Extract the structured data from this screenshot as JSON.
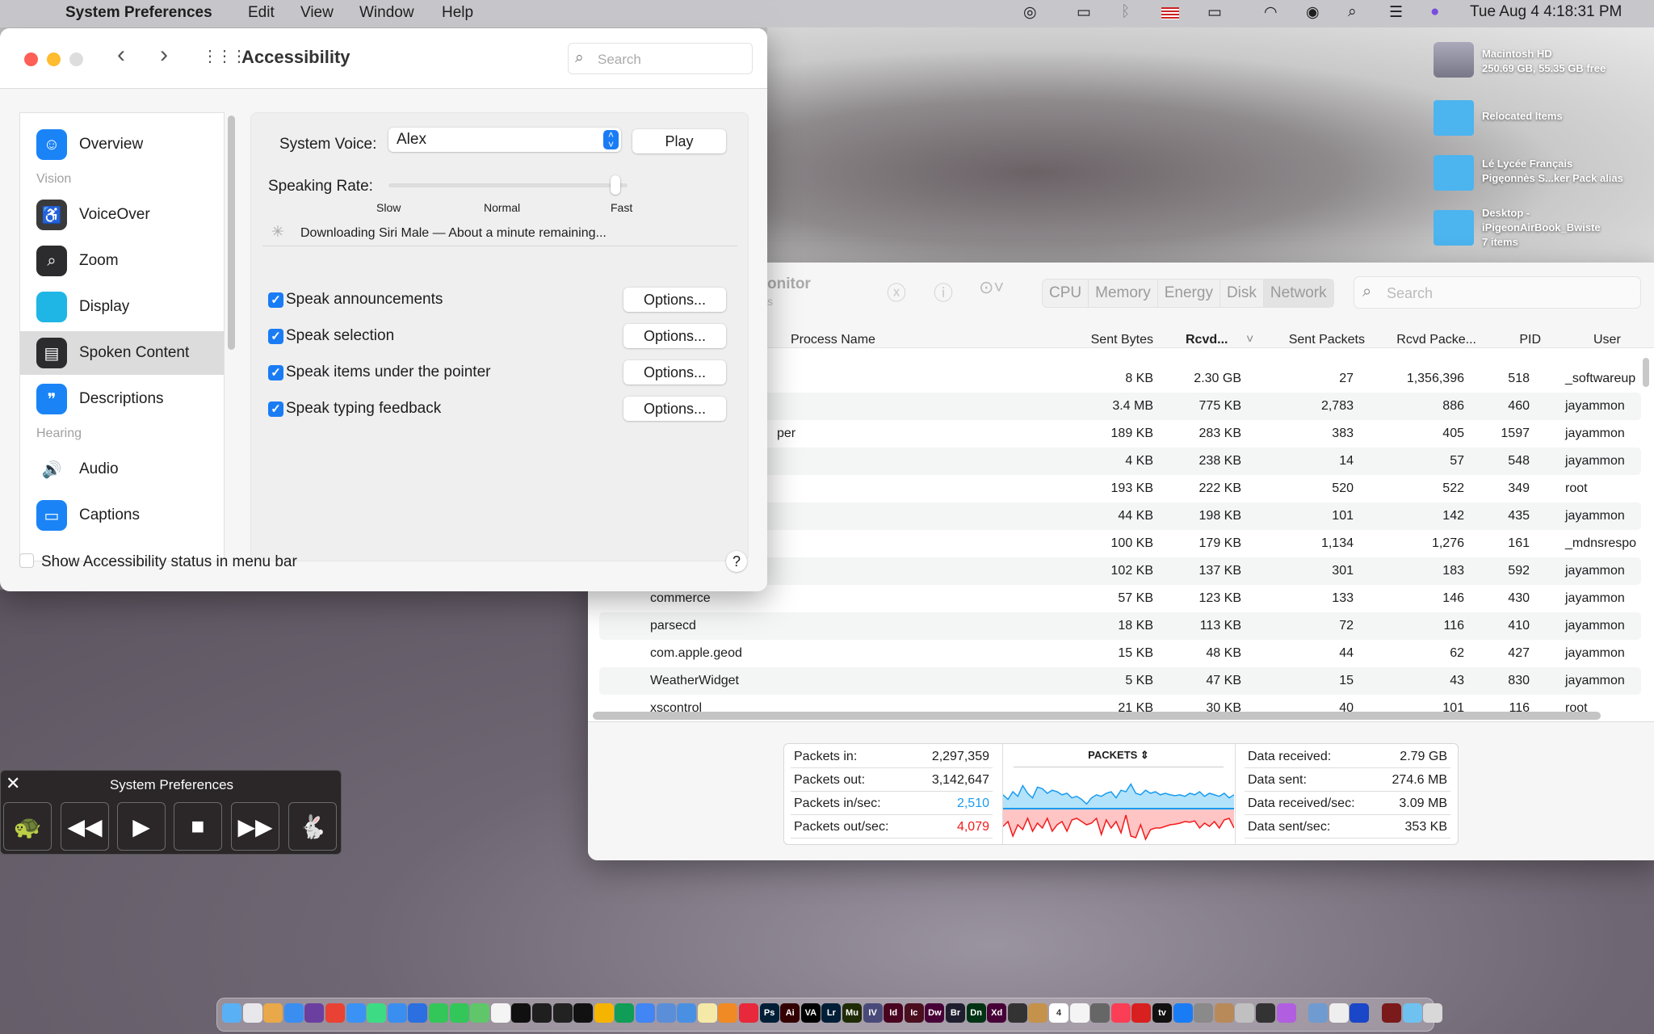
{
  "menubar": {
    "app": "System Preferences",
    "items": [
      "Edit",
      "View",
      "Window",
      "Help"
    ],
    "clock": "Tue Aug 4  4:18:31 PM",
    "status_icons": [
      "creative-cloud-icon",
      "display-icon",
      "bluetooth-icon",
      "us-flag-icon",
      "battery-charging-icon",
      "wifi-icon",
      "user-icon",
      "spotlight-icon",
      "control-center-icon",
      "siri-icon"
    ]
  },
  "desktop": {
    "items": [
      {
        "name": "Macintosh HD",
        "sub": "250.69 GB, 55.35 GB free",
        "icon": "hard-drive-icon"
      },
      {
        "name": "Relocated Items",
        "sub": "",
        "icon": "folder-alias-icon"
      },
      {
        "name": "Lé Lycée Français",
        "sub": "Pigęonnès S...ker Pack alias",
        "icon": "folder-alias-icon"
      },
      {
        "name": "Desktop -",
        "sub": "iPigeonAirBook_Bwiste",
        "sub2": "7 items",
        "icon": "folder-icon"
      }
    ]
  },
  "prefs": {
    "title": "Accessibility",
    "search_placeholder": "Search",
    "sidebar": [
      {
        "label": "Overview",
        "type": "item",
        "color": "#1a84f7",
        "glyph": "☺"
      },
      {
        "label": "Vision",
        "type": "group"
      },
      {
        "label": "VoiceOver",
        "type": "item",
        "color": "#3a3a3c",
        "glyph": "♿"
      },
      {
        "label": "Zoom",
        "type": "item",
        "color": "#2c2c2e",
        "glyph": "⌕"
      },
      {
        "label": "Display",
        "type": "item",
        "color": "#1fb6e6",
        "glyph": ""
      },
      {
        "label": "Spoken Content",
        "type": "item",
        "color": "#2c2c2e",
        "glyph": "▤",
        "selected": true
      },
      {
        "label": "Descriptions",
        "type": "item",
        "color": "#1a84f7",
        "glyph": "❞"
      },
      {
        "label": "Hearing",
        "type": "group"
      },
      {
        "label": "Audio",
        "type": "item",
        "color": "transparent",
        "glyph": "🔊"
      },
      {
        "label": "Captions",
        "type": "item",
        "color": "#1a84f7",
        "glyph": "▭"
      }
    ],
    "system_voice_label": "System Voice:",
    "system_voice": "Alex",
    "play": "Play",
    "rate_label": "Speaking Rate:",
    "rate_ticks": [
      "Slow",
      "Normal",
      "Fast"
    ],
    "rate_value": 0.95,
    "download_status": "Downloading Siri Male — About a minute remaining...",
    "options": [
      {
        "label": "Speak announcements",
        "checked": true,
        "button": "Options..."
      },
      {
        "label": "Speak selection",
        "checked": true,
        "button": "Options..."
      },
      {
        "label": "Speak items under the pointer",
        "checked": true,
        "button": "Options..."
      },
      {
        "label": "Speak typing feedback",
        "checked": true,
        "button": "Options..."
      }
    ],
    "status_menu_label": "Show Accessibility status in menu bar",
    "status_menu_checked": false,
    "help": "?"
  },
  "activity": {
    "title_fragment": "onitor",
    "subtitle_fragment": "s",
    "tabs": [
      "CPU",
      "Memory",
      "Energy",
      "Disk",
      "Network"
    ],
    "active_tab": "Network",
    "search_placeholder": "Search",
    "columns": [
      "Process Name",
      "Sent Bytes",
      "Rcvd...",
      "Sent Packets",
      "Rcvd Packe...",
      "PID",
      "User"
    ],
    "rows": [
      {
        "name": "",
        "sent": "8 KB",
        "rcvd": "2.30 GB",
        "sp": "27",
        "rp": "1,356,396",
        "pid": "518",
        "user": "_softwareup"
      },
      {
        "name": "",
        "sent": "3.4 MB",
        "rcvd": "775 KB",
        "sp": "2,783",
        "rp": "886",
        "pid": "460",
        "user": "jayammon"
      },
      {
        "name": "per",
        "sent": "189 KB",
        "rcvd": "283 KB",
        "sp": "383",
        "rp": "405",
        "pid": "1597",
        "user": "jayammon"
      },
      {
        "name": "",
        "sent": "4 KB",
        "rcvd": "238 KB",
        "sp": "14",
        "rp": "57",
        "pid": "548",
        "user": "jayammon"
      },
      {
        "name": "",
        "sent": "193 KB",
        "rcvd": "222 KB",
        "sp": "520",
        "rp": "522",
        "pid": "349",
        "user": "root"
      },
      {
        "name": "",
        "sent": "44 KB",
        "rcvd": "198 KB",
        "sp": "101",
        "rp": "142",
        "pid": "435",
        "user": "jayammon"
      },
      {
        "name": "",
        "sent": "100 KB",
        "rcvd": "179 KB",
        "sp": "1,134",
        "rp": "1,276",
        "pid": "161",
        "user": "_mdnsrespo"
      },
      {
        "name": "",
        "sent": "102 KB",
        "rcvd": "137 KB",
        "sp": "301",
        "rp": "183",
        "pid": "592",
        "user": "jayammon"
      },
      {
        "name": "commerce",
        "sent": "57 KB",
        "rcvd": "123 KB",
        "sp": "133",
        "rp": "146",
        "pid": "430",
        "user": "jayammon"
      },
      {
        "name": "parsecd",
        "sent": "18 KB",
        "rcvd": "113 KB",
        "sp": "72",
        "rp": "116",
        "pid": "410",
        "user": "jayammon"
      },
      {
        "name": "com.apple.geod",
        "sent": "15 KB",
        "rcvd": "48 KB",
        "sp": "44",
        "rp": "62",
        "pid": "427",
        "user": "jayammon"
      },
      {
        "name": "WeatherWidget",
        "sent": "5 KB",
        "rcvd": "47 KB",
        "sp": "15",
        "rp": "43",
        "pid": "830",
        "user": "jayammon"
      },
      {
        "name": "xscontrol",
        "sent": "21 KB",
        "rcvd": "30 KB",
        "sp": "40",
        "rp": "101",
        "pid": "116",
        "user": "root"
      }
    ],
    "stats_left": [
      {
        "label": "Packets in:",
        "value": "2,297,359",
        "color": "#1d1d1f"
      },
      {
        "label": "Packets out:",
        "value": "3,142,647",
        "color": "#1d1d1f"
      },
      {
        "label": "Packets in/sec:",
        "value": "2,510",
        "color": "#1a9bf0"
      },
      {
        "label": "Packets out/sec:",
        "value": "4,079",
        "color": "#f21b1b"
      }
    ],
    "graph_title": "PACKETS",
    "packets_in_series": [
      0.45,
      0.3,
      0.55,
      0.4,
      0.75,
      0.5,
      0.35,
      0.7,
      0.65,
      0.5,
      0.6,
      0.55,
      0.45,
      0.5,
      0.35,
      0.4,
      0.3,
      0.15,
      0.35,
      0.45,
      0.4,
      0.5,
      0.55,
      0.35,
      0.6,
      0.55,
      0.8,
      0.5,
      0.45,
      0.6,
      0.5,
      0.55,
      0.45,
      0.5,
      0.45,
      0.42,
      0.45,
      0.4,
      0.5,
      0.45,
      0.55,
      0.4,
      0.5,
      0.45,
      0.4,
      0.5,
      0.35,
      0.45
    ],
    "packets_out_series": [
      0.55,
      0.4,
      0.85,
      0.5,
      0.65,
      0.3,
      0.7,
      0.45,
      0.6,
      0.3,
      0.7,
      0.5,
      0.4,
      0.7,
      0.35,
      0.3,
      0.4,
      0.5,
      0.45,
      0.3,
      0.8,
      0.35,
      0.6,
      0.4,
      0.75,
      0.2,
      0.85,
      0.9,
      0.5,
      0.95,
      0.65,
      0.6,
      0.6,
      0.55,
      0.5,
      0.48,
      0.45,
      0.4,
      0.42,
      0.38,
      0.6,
      0.45,
      0.55,
      0.4,
      0.6,
      0.35,
      0.3,
      0.6
    ],
    "stats_right": [
      {
        "label": "Data received:",
        "value": "2.79 GB"
      },
      {
        "label": "Data sent:",
        "value": "274.6 MB"
      },
      {
        "label": "Data received/sec:",
        "value": "3.09 MB"
      },
      {
        "label": "Data sent/sec:",
        "value": "353 KB"
      }
    ]
  },
  "speech_controller": {
    "title": "System Preferences",
    "buttons": [
      "slower",
      "rewind",
      "play",
      "stop",
      "fast-forward",
      "faster"
    ]
  },
  "colors": {
    "accent": "#1a7cf5",
    "in": "#1a9bf0",
    "out": "#f21b1b"
  },
  "dock": [
    [
      "#5ab0f5",
      ""
    ],
    [
      "#e8e8ec",
      ""
    ],
    [
      "#e9a84a",
      ""
    ],
    [
      "#3a8ef0",
      ""
    ],
    [
      "#6b3fa0",
      ""
    ],
    [
      "#e94235",
      ""
    ],
    [
      "#3a92f5",
      ""
    ],
    [
      "#3ddc84",
      ""
    ],
    [
      "#3a8ef0",
      ""
    ],
    [
      "#2b6fe0",
      ""
    ],
    [
      "#33c659",
      ""
    ],
    [
      "#33c659",
      ""
    ],
    [
      "#5fc76a",
      ""
    ],
    [
      "#f4f4f4",
      ""
    ],
    [
      "#101010",
      ""
    ],
    [
      "#1f1f1f",
      ""
    ],
    [
      "#222",
      ""
    ],
    [
      "#111",
      ""
    ],
    [
      "#f5b400",
      ""
    ],
    [
      "#0f9d58",
      ""
    ],
    [
      "#4285f4",
      ""
    ],
    [
      "#5b8ed8",
      ""
    ],
    [
      "#4a90e2",
      ""
    ],
    [
      "#f5e9a8",
      ""
    ],
    [
      "#f08a24",
      ""
    ],
    [
      "#e8283b",
      ""
    ],
    [
      "#001e36",
      "Ps"
    ],
    [
      "#330000",
      "Ai"
    ],
    [
      "#000",
      "VA"
    ],
    [
      "#001e36",
      "Lr"
    ],
    [
      "#1f2b05",
      "Mu"
    ],
    [
      "#4a4a7a",
      "IV"
    ],
    [
      "#49021f",
      "Id"
    ],
    [
      "#4a0e1f",
      "Ic"
    ],
    [
      "#470137",
      "Dw"
    ],
    [
      "#1e1e2e",
      "Br"
    ],
    [
      "#003313",
      "Dn"
    ],
    [
      "#470137",
      "Xd"
    ],
    [
      "#333",
      ""
    ],
    [
      "#c4924a",
      ""
    ],
    [
      "#fff",
      "4"
    ],
    [
      "#f4f4f4",
      ""
    ],
    [
      "#666",
      ""
    ],
    [
      "#fa3e55",
      ""
    ],
    [
      "#d7201f",
      ""
    ],
    [
      "#111",
      "tv"
    ],
    [
      "#1a7cf5",
      ""
    ],
    [
      "#8a8a8a",
      ""
    ],
    [
      "#b88a5a",
      ""
    ],
    [
      "#c0c0c0",
      ""
    ],
    [
      "#333",
      ""
    ],
    [
      "#b15ee0",
      ""
    ],
    [
      "#6f9bd0",
      ""
    ],
    [
      "#eee",
      ""
    ],
    [
      "#1a46c8",
      ""
    ],
    [
      "#7a1a1a",
      ""
    ],
    [
      "#6fc2f0",
      ""
    ],
    [
      "#d8d8d8",
      ""
    ]
  ]
}
